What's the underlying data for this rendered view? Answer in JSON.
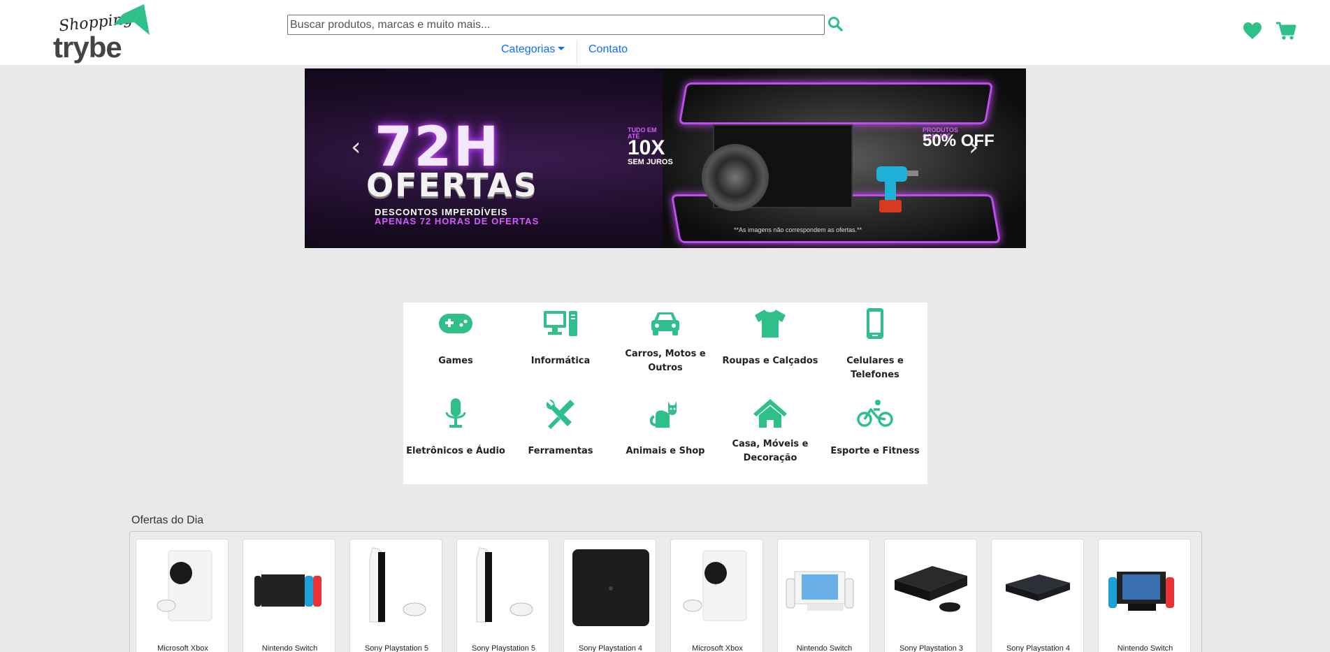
{
  "header": {
    "logo_script": "Shopping",
    "logo_word": "trybe",
    "search_placeholder": "Buscar produtos, marcas e muito mais...",
    "nav": {
      "categories": "Categorias",
      "contact": "Contato"
    },
    "icons": {
      "search": "search-icon",
      "favorites": "heart-icon",
      "cart": "cart-icon"
    },
    "accent_color": "#2fbf8a"
  },
  "banner": {
    "headline": "72H",
    "subheadline": "OFERTAS",
    "desc_line1": "DESCONTOS IMPERDÍVEIS",
    "desc_line2": "APENAS 72 HORAS DE OFERTAS",
    "promo1_top": "TUDO EM ATÉ",
    "promo1_big": "10X",
    "promo1_bottom": "SEM JUROS",
    "promo2_top": "PRODUTOS COM ATÉ",
    "promo2_big": "50% OFF",
    "disclaimer": "**As imagens não correspondem as ofertas.**",
    "prev": "‹",
    "next": "›"
  },
  "categories": [
    {
      "label": "Games",
      "icon": "gamepad-icon"
    },
    {
      "label": "Informática",
      "icon": "computer-icon"
    },
    {
      "label": "Carros, Motos e Outros",
      "icon": "car-icon"
    },
    {
      "label": "Roupas e Calçados",
      "icon": "shirt-icon"
    },
    {
      "label": "Celulares e Telefones",
      "icon": "phone-icon"
    },
    {
      "label": "Eletrônicos e Áudio",
      "icon": "microphone-icon"
    },
    {
      "label": "Ferramentas",
      "icon": "tools-icon"
    },
    {
      "label": "Animais e Shop",
      "icon": "cat-icon"
    },
    {
      "label": "Casa, Móveis e Decoração",
      "icon": "house-icon"
    },
    {
      "label": "Esporte e Fitness",
      "icon": "bicycle-icon"
    }
  ],
  "offers": {
    "title": "Ofertas do Dia",
    "products": [
      {
        "name": "Microsoft Xbox",
        "kind": "xbox-series-s"
      },
      {
        "name": "Nintendo Switch",
        "kind": "switch"
      },
      {
        "name": "Sony Playstation 5",
        "kind": "ps5"
      },
      {
        "name": "Sony Playstation 5",
        "kind": "ps5"
      },
      {
        "name": "Sony Playstation 4",
        "kind": "ps4-slim"
      },
      {
        "name": "Microsoft Xbox",
        "kind": "xbox-series-s"
      },
      {
        "name": "Nintendo Switch",
        "kind": "switch-oled"
      },
      {
        "name": "Sony Playstation 3",
        "kind": "ps3"
      },
      {
        "name": "Sony Playstation 4",
        "kind": "ps4"
      },
      {
        "name": "Nintendo Switch",
        "kind": "switch-oled"
      }
    ]
  }
}
